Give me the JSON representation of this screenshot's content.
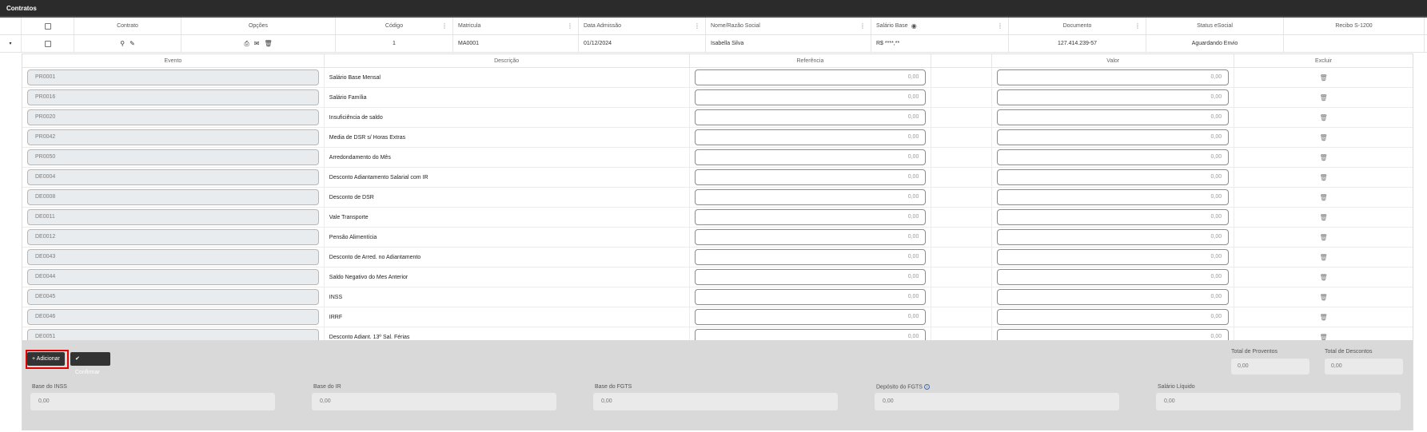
{
  "window": {
    "title": "Contratos"
  },
  "contracts_table": {
    "headers": {
      "contrato": "Contrato",
      "opcoes": "Opções",
      "codigo": "Código",
      "matricula": "Matricula",
      "data_admissao": "Data Admissão",
      "nome": "Nome/Razão Social",
      "salario_base": "Salário Base",
      "documento": "Documento",
      "status": "Status eSocial",
      "recibo": "Recibo S-1200"
    },
    "row": {
      "codigo": "1",
      "matricula": "MA0001",
      "data_admissao": "01/12/2024",
      "nome": "Isabella Silva",
      "salario_base": "R$ ****,**",
      "documento": "127.414.239-57",
      "status": "Aguardando Envio",
      "recibo": ""
    }
  },
  "events_table": {
    "headers": {
      "evento": "Evento",
      "descricao": "Descrição",
      "referencia": "Referência",
      "valor": "Valor",
      "excluir": "Excluir"
    },
    "rows": [
      {
        "evento": "PR0001",
        "descricao": "Salário Base Mensal",
        "referencia": "0,00",
        "valor": "0,00"
      },
      {
        "evento": "PR0016",
        "descricao": "Salário Família",
        "referencia": "0,00",
        "valor": "0,00"
      },
      {
        "evento": "PR0020",
        "descricao": "Insuficiência de saldo",
        "referencia": "0,00",
        "valor": "0,00"
      },
      {
        "evento": "PR0042",
        "descricao": "Media de DSR s/ Horas Extras",
        "referencia": "0,00",
        "valor": "0,00"
      },
      {
        "evento": "PR0050",
        "descricao": "Arredondamento do Mês",
        "referencia": "0,00",
        "valor": "0,00"
      },
      {
        "evento": "DE0004",
        "descricao": "Desconto Adiantamento Salarial com IR",
        "referencia": "0,00",
        "valor": "0,00"
      },
      {
        "evento": "DE0008",
        "descricao": "Desconto de DSR",
        "referencia": "0,00",
        "valor": "0,00"
      },
      {
        "evento": "DE0011",
        "descricao": "Vale Transporte",
        "referencia": "0,00",
        "valor": "0,00"
      },
      {
        "evento": "DE0012",
        "descricao": "Pensão Alimentícia",
        "referencia": "0,00",
        "valor": "0,00"
      },
      {
        "evento": "DE0043",
        "descricao": "Desconto de Arred. no Adiantamento",
        "referencia": "0,00",
        "valor": "0,00"
      },
      {
        "evento": "DE0044",
        "descricao": "Saldo Negativo do Mes Anterior",
        "referencia": "0,00",
        "valor": "0,00"
      },
      {
        "evento": "DE0045",
        "descricao": "INSS",
        "referencia": "0,00",
        "valor": "0,00"
      },
      {
        "evento": "DE0046",
        "descricao": "IRRF",
        "referencia": "0,00",
        "valor": "0,00"
      },
      {
        "evento": "DE0051",
        "descricao": "Desconto Adiant. 13º Sal. Férias",
        "referencia": "0,00",
        "valor": "0,00"
      }
    ]
  },
  "actions": {
    "add_label": "Adicionar",
    "confirm_label": "Confirmar",
    "add_icon": "+",
    "confirm_icon": "✔"
  },
  "totals": {
    "proventos_label": "Total de Proventos",
    "proventos_value": "0,00",
    "descontos_label": "Total de Descontos",
    "descontos_value": "0,00"
  },
  "bases": {
    "inss_label": "Base do INSS",
    "inss_value": "0,00",
    "ir_label": "Base do IR",
    "ir_value": "0,00",
    "fgts_label": "Base do FGTS",
    "fgts_value": "0,00",
    "deposito_label": "Depósito do FGTS",
    "deposito_value": "0,00",
    "liquido_label": "Salário Líquido",
    "liquido_value": "0,00"
  },
  "colors": {
    "title_bg": "#2b2b2b",
    "highlight": "#e00000",
    "footer_bg": "#d9d9d9"
  },
  "icons": {
    "expand": "chevron-down-icon",
    "search": "search-icon",
    "edit": "edit-icon",
    "print": "print-icon",
    "mail": "mail-icon",
    "trash": "trash-icon",
    "visibility": "eye-icon",
    "info": "info-icon"
  }
}
